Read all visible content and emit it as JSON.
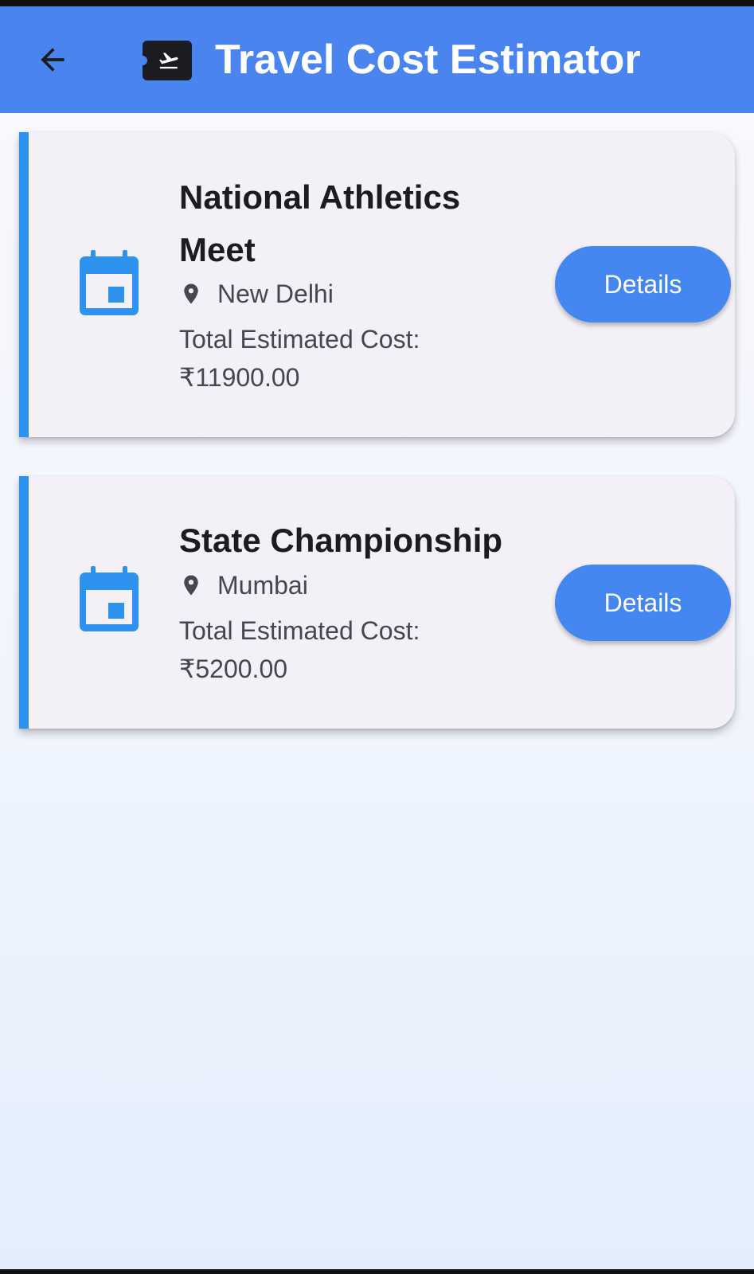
{
  "app_bar": {
    "title": "Travel Cost Estimator",
    "back_icon": "arrow-back-icon",
    "title_icon": "flight-ticket-icon",
    "background_color": "#4a85ef"
  },
  "events": [
    {
      "title": "National Athletics Meet",
      "location": "New Delhi",
      "cost_label": "Total Estimated Cost:",
      "cost_value": "₹11900.00",
      "button_label": "Details",
      "icon": "calendar-icon"
    },
    {
      "title": "State Championship",
      "location": "Mumbai",
      "cost_label": "Total Estimated Cost:",
      "cost_value": "₹5200.00",
      "button_label": "Details",
      "icon": "calendar-icon"
    }
  ],
  "colors": {
    "accent": "#2e93ef",
    "button": "#4587f0",
    "card_background": "#f4f0f8"
  }
}
